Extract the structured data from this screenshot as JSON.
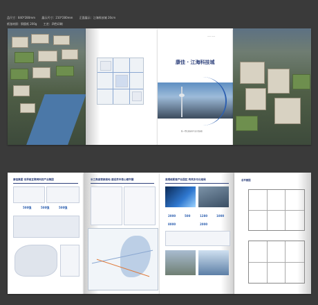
{
  "header": {
    "row1": [
      "品尺寸：840*280mm",
      "展示尺寸：210*280mm",
      "正面展示：江海科技城 20cm"
    ],
    "row2": [
      "纸张材质：铜版纸 200g",
      "工艺：四色印刷"
    ]
  },
  "cover": {
    "title": "康佳 · 江海科技城",
    "small_top": "—— ——",
    "footer": "新一代信息技术产业示范园区"
  },
  "inner1": {
    "title": "康佳集团 世界级互联网科技产业集团",
    "badges": [
      "500强",
      "500强",
      "500强"
    ]
  },
  "inner2": {
    "title": "长三角高铁新高地 建设苏中核心都市圈"
  },
  "inner3": {
    "title": "高规格配套产业园区 构筑多元化格局",
    "stats": [
      "2000",
      "500",
      "1280",
      "1000",
      "8000",
      "2000"
    ]
  },
  "inner4": {
    "title": "总平面图"
  }
}
